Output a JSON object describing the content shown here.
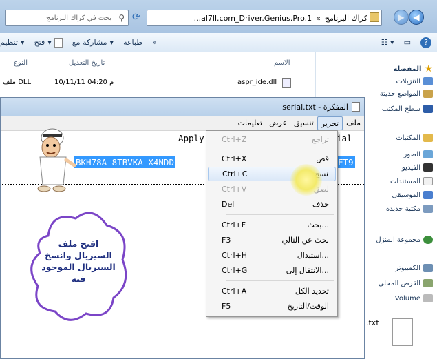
{
  "explorer": {
    "address_path": "...al7ll.com_Driver.Genius.Pro.1",
    "address_current": "كراك البرنامج",
    "search_placeholder": "بحث في كراك البرنامج",
    "toolbar": {
      "organize": "تنظيم",
      "open": "فتح",
      "share_with": "مشاركة مع",
      "print": "طباعة"
    },
    "columns": {
      "name": "الاسم",
      "date_modified": "تاريخ التعديل",
      "type": "النوع"
    },
    "rows": [
      {
        "name": "aspr_ide.dll",
        "date": "10/11/11 م 04:20",
        "type": "ملف DLL"
      }
    ],
    "sidebar": {
      "favorites": "المفضلة",
      "downloads": "التنزيلات",
      "recent_places": "المواضع حديثة",
      "desktop": "سطح المكتب",
      "libraries": "المكتبات",
      "pictures": "الصور",
      "videos": "الفيديو",
      "documents": "المستندات",
      "music": "الموسيقى",
      "library_item": "مكتبة جديدة",
      "homegroup": "مجموعة المنزل",
      "computer": "الكمبيوتر",
      "local_disk": "القرص المحلي",
      "volume": "Volume"
    },
    "bottom_file": ".txt"
  },
  "notepad": {
    "title": "serial.txt - المفكرة",
    "menu": {
      "file": "ملف",
      "edit": "تحرير",
      "format": "تنسيق",
      "view": "عرض",
      "help": "تعليمات"
    },
    "line1_left": "Apply",
    "line1_right": "ial",
    "serial": "BKH78A-8TBVKA-X4NDD",
    "serial_tail": "FT9"
  },
  "context_menu": {
    "items": [
      {
        "label": "تراجع",
        "shortcut": "Ctrl+Z",
        "disabled": true
      },
      {
        "label": "قص",
        "shortcut": "Ctrl+X",
        "disabled": false
      },
      {
        "label": "نسخ",
        "shortcut": "Ctrl+C",
        "disabled": false
      },
      {
        "label": "لصق",
        "shortcut": "Ctrl+V",
        "disabled": true
      },
      {
        "label": "حذف",
        "shortcut": "Del",
        "disabled": false
      },
      {
        "label": "بحث...",
        "shortcut": "Ctrl+F",
        "disabled": false
      },
      {
        "label": "بحث عن التالي",
        "shortcut": "F3",
        "disabled": false
      },
      {
        "label": "استبدال...",
        "shortcut": "Ctrl+H",
        "disabled": false
      },
      {
        "label": "الانتقال إلى...",
        "shortcut": "Ctrl+G",
        "disabled": false
      },
      {
        "label": "تحديد الكل",
        "shortcut": "Ctrl+A",
        "disabled": false
      },
      {
        "label": "الوقت/التاريخ",
        "shortcut": "F5",
        "disabled": false
      }
    ]
  },
  "callout": {
    "line1": "افتح ملف",
    "line2": "السيريال وانسخ",
    "line3": "السيريال الموجود",
    "line4": "فيه"
  }
}
